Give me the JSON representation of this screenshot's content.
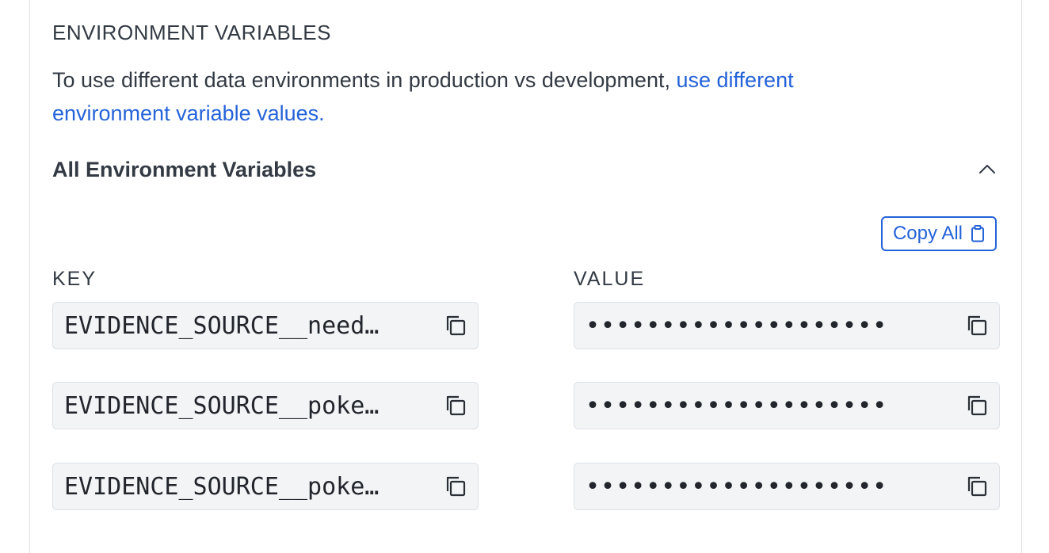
{
  "section": {
    "heading": "ENVIRONMENT VARIABLES",
    "description_prefix": "To use different data environments in production vs development, ",
    "description_link": "use different environment variable values."
  },
  "accordion": {
    "title": "All Environment Variables",
    "expanded": true,
    "toggle_icon": "chevron-up-icon"
  },
  "copy_all": {
    "label": "Copy All",
    "icon": "clipboard-icon"
  },
  "columns": {
    "key": "KEY",
    "value": "VALUE"
  },
  "variables": [
    {
      "key": "EVIDENCE_SOURCE__needful_things__...",
      "key_display": "EVIDENCE_SOURCE__need…",
      "value_display": "••••••••••••••••••••"
    },
    {
      "key_display": "EVIDENCE_SOURCE__poke…",
      "value_display": "••••••••••••••••••••"
    },
    {
      "key_display": "EVIDENCE_SOURCE__poke…",
      "value_display": "••••••••••••••••••••"
    }
  ],
  "colors": {
    "accent": "#2563d9",
    "field_background": "#f2f4f6",
    "border": "#dde1e6",
    "text": "#333a44"
  }
}
